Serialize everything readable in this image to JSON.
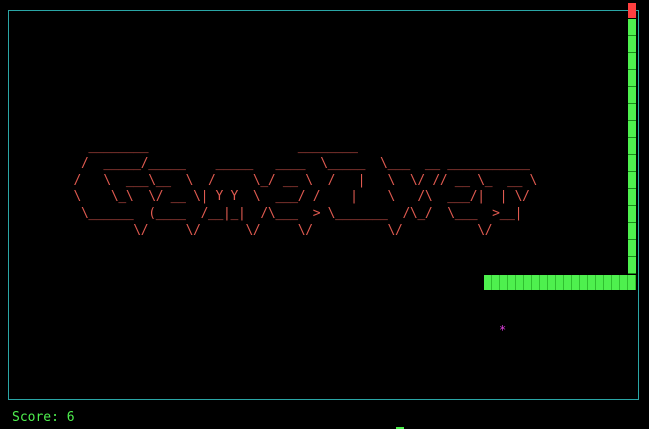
{
  "game": {
    "title_art": "   ________                    ________\n  /  _____/_____    _____   ____  \\_____  \\___  __ ___________\n /   \\  ___\\__  \\  /     \\_/ __ \\  /   |   \\  \\/ // __ \\_  __ \\\n \\    \\_\\  \\/ __ \\| Y Y  \\  ___/ /    |    \\   /\\  ___/|  | \\/\n  \\______  (____  /__|_|  /\\___  > \\_______  /\\_/  \\___  >__|\n         \\/     \\/      \\/     \\/          \\/          \\/",
    "food_symbol": "*",
    "score_label": "Score: 6"
  },
  "colors": {
    "border": "#2aa6a6",
    "title": "#e05a50",
    "snake_body": "#4ef04e",
    "snake_head": "#ff4040",
    "food": "#e040e0",
    "score": "#4ef04e",
    "background": "#000000"
  }
}
